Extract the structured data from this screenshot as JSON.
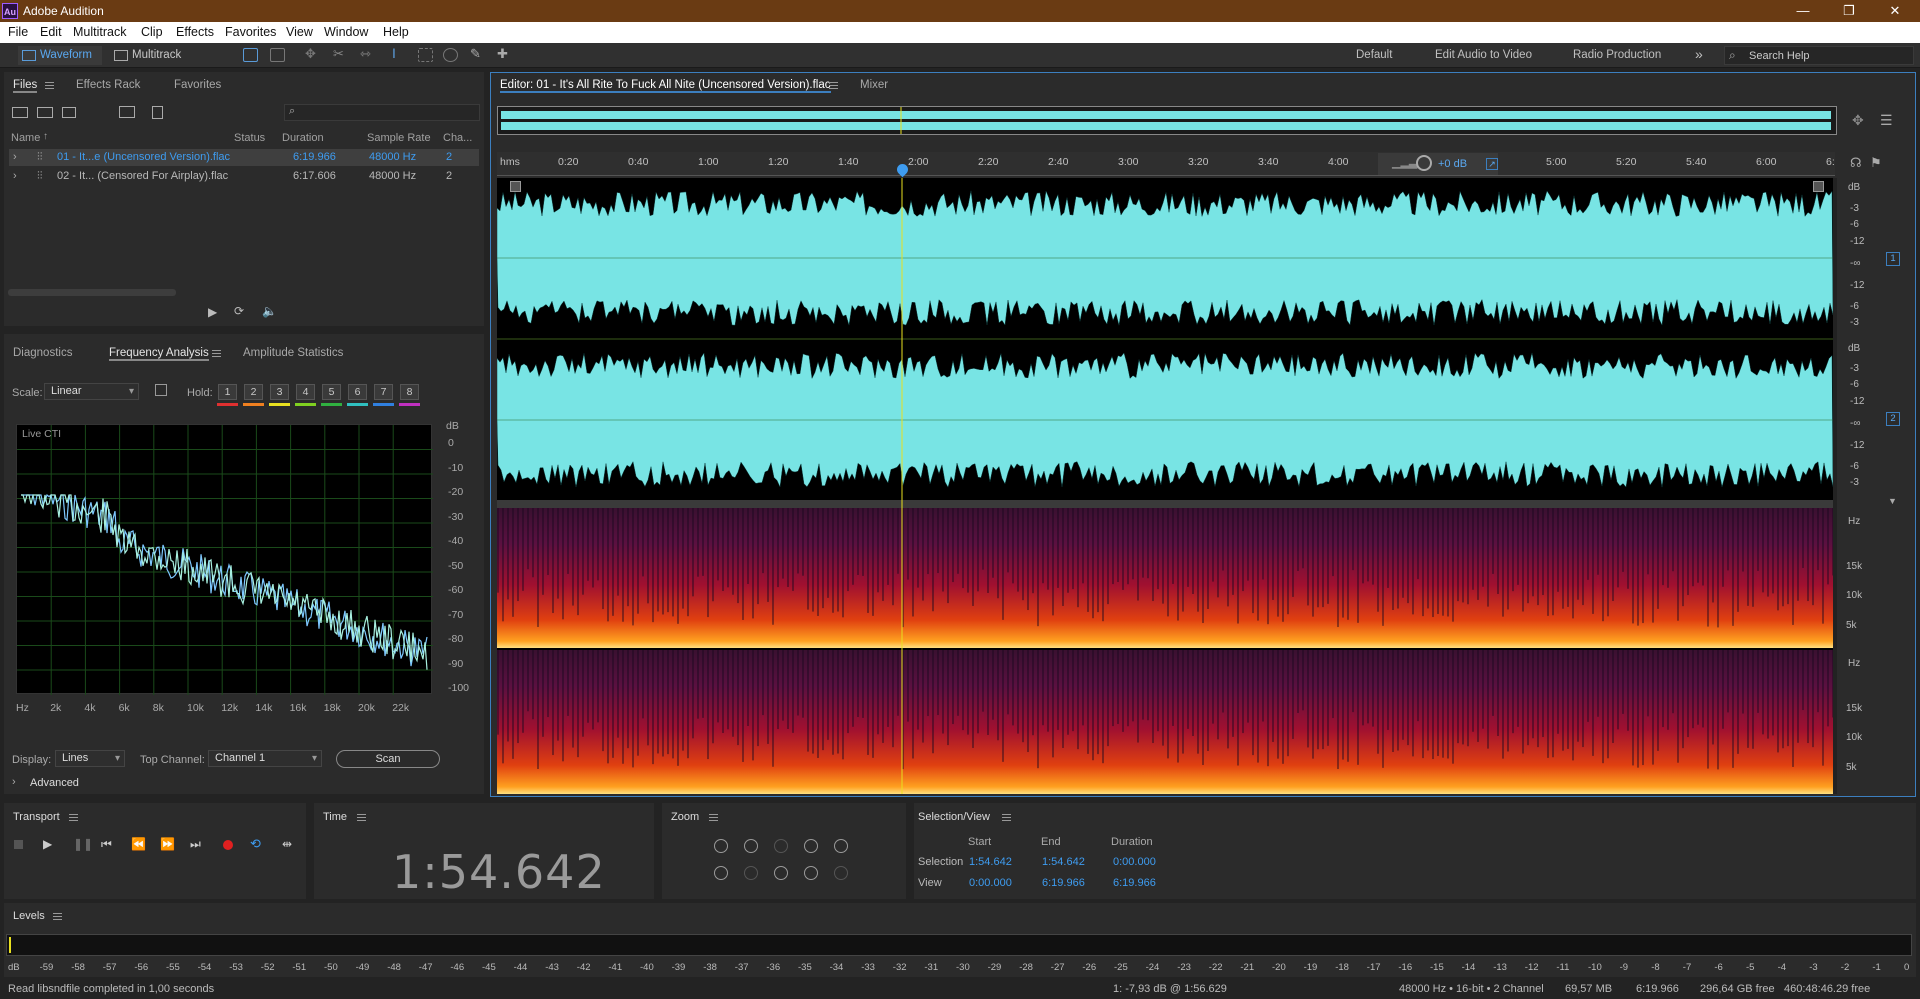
{
  "app": {
    "title": "Adobe Audition",
    "logo": "Au"
  },
  "menu": [
    "File",
    "Edit",
    "Multitrack",
    "Clip",
    "Effects",
    "Favorites",
    "View",
    "Window",
    "Help"
  ],
  "toolbar": {
    "waveform": "Waveform",
    "multitrack": "Multitrack",
    "workspaces": [
      "Default",
      "Edit Audio to Video",
      "Radio Production"
    ],
    "more": "»",
    "search_placeholder": "Search Help"
  },
  "files_panel": {
    "tabs": [
      "Files",
      "Effects Rack",
      "Favorites"
    ],
    "columns": [
      "Name",
      "Status",
      "Duration",
      "Sample Rate",
      "Cha..."
    ],
    "rows": [
      {
        "name": "01 - It...e (Uncensored Version).flac",
        "status": "",
        "duration": "6:19.966",
        "rate": "48000 Hz",
        "channels": "2",
        "selected": true
      },
      {
        "name": "02 - It... (Censored For Airplay).flac",
        "status": "",
        "duration": "6:17.606",
        "rate": "48000 Hz",
        "channels": "2",
        "selected": false
      }
    ]
  },
  "analysis": {
    "tabs": [
      "Diagnostics",
      "Frequency Analysis",
      "Amplitude Statistics"
    ],
    "scale_label": "Scale:",
    "scale_value": "Linear",
    "hold_label": "Hold:",
    "holds": [
      "1",
      "2",
      "3",
      "4",
      "5",
      "6",
      "7",
      "8"
    ],
    "hold_colors": [
      "#e03030",
      "#f08020",
      "#e8e020",
      "#80d020",
      "#30b040",
      "#30c0c0",
      "#3080e0",
      "#c030c0"
    ],
    "graph_label": "Live CTI",
    "db_unit": "dB",
    "db_ticks": [
      "0",
      "-10",
      "-20",
      "-30",
      "-40",
      "-50",
      "-60",
      "-70",
      "-80",
      "-90",
      "-100"
    ],
    "hz_ticks": [
      "Hz",
      "2k",
      "4k",
      "6k",
      "8k",
      "10k",
      "12k",
      "14k",
      "16k",
      "18k",
      "20k",
      "22k"
    ],
    "display_label": "Display:",
    "display_value": "Lines",
    "top_channel_label": "Top Channel:",
    "top_channel_value": "Channel 1",
    "scan": "Scan",
    "advanced": "Advanced"
  },
  "editor": {
    "tab": "Editor: 01 - It's All Rite To Fuck All Nite (Uncensored Version).flac",
    "mixer": "Mixer",
    "ruler": [
      "hms",
      "0:20",
      "0:40",
      "1:00",
      "1:20",
      "1:40",
      "2:00",
      "2:20",
      "2:40",
      "3:00",
      "3:20",
      "3:40",
      "4:00",
      "5:00",
      "5:20",
      "5:40",
      "6:00",
      "6:"
    ],
    "hud": "+0 dB",
    "db_labels": [
      "dB",
      "-3",
      "-6",
      "-12",
      "-∞",
      "-12",
      "-6",
      "-3"
    ],
    "channels": [
      "1",
      "2"
    ],
    "hz_unit": "Hz",
    "hz_labels": [
      "15k",
      "10k",
      "5k"
    ],
    "wave_color": "#78e4e4"
  },
  "transport": {
    "title": "Transport"
  },
  "time": {
    "title": "Time",
    "value": "1:54.642"
  },
  "zoom": {
    "title": "Zoom"
  },
  "selection": {
    "title": "Selection/View",
    "headers": [
      "Start",
      "End",
      "Duration"
    ],
    "selection_label": "Selection",
    "selection": [
      "1:54.642",
      "1:54.642",
      "0:00.000"
    ],
    "view_label": "View",
    "view": [
      "0:00.000",
      "6:19.966",
      "6:19.966"
    ]
  },
  "levels": {
    "title": "Levels",
    "ticks": [
      "dB",
      "-59",
      "-58",
      "-57",
      "-56",
      "-55",
      "-54",
      "-53",
      "-52",
      "-51",
      "-50",
      "-49",
      "-48",
      "-47",
      "-46",
      "-45",
      "-44",
      "-43",
      "-42",
      "-41",
      "-40",
      "-39",
      "-38",
      "-37",
      "-36",
      "-35",
      "-34",
      "-33",
      "-32",
      "-31",
      "-30",
      "-29",
      "-28",
      "-27",
      "-26",
      "-25",
      "-24",
      "-23",
      "-22",
      "-21",
      "-20",
      "-19",
      "-18",
      "-17",
      "-16",
      "-15",
      "-14",
      "-13",
      "-12",
      "-11",
      "-10",
      "-9",
      "-8",
      "-7",
      "-6",
      "-5",
      "-4",
      "-3",
      "-2",
      "-1",
      "0"
    ]
  },
  "status": {
    "left": "Read libsndfile completed in 1,00 seconds",
    "cursor": "1: -7,93 dB @ 1:56.629",
    "format": "48000 Hz • 16-bit • 2 Channel",
    "size": "69,57 MB",
    "duration": "6:19.966",
    "disk": "296,64 GB free",
    "free_time": "460:48:46.29 free"
  }
}
